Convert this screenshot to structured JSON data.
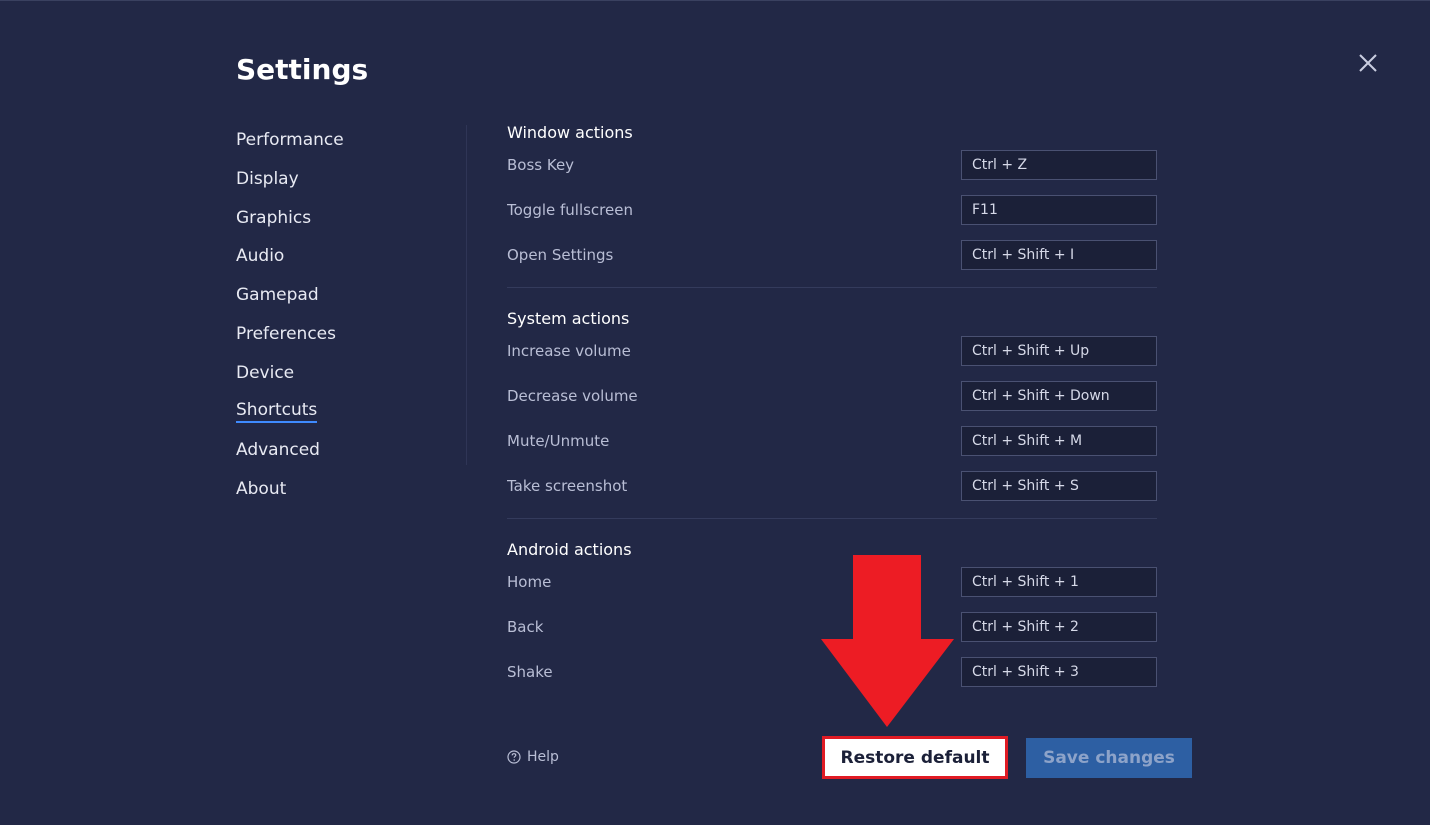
{
  "header": {
    "title": "Settings"
  },
  "sidebar": {
    "items": [
      {
        "label": "Performance"
      },
      {
        "label": "Display"
      },
      {
        "label": "Graphics"
      },
      {
        "label": "Audio"
      },
      {
        "label": "Gamepad"
      },
      {
        "label": "Preferences"
      },
      {
        "label": "Device"
      },
      {
        "label": "Shortcuts",
        "active": true
      },
      {
        "label": "Advanced"
      },
      {
        "label": "About"
      }
    ]
  },
  "sections": [
    {
      "title": "Window actions",
      "rows": [
        {
          "label": "Boss Key",
          "value": "Ctrl + Z"
        },
        {
          "label": "Toggle fullscreen",
          "value": "F11"
        },
        {
          "label": "Open Settings",
          "value": "Ctrl + Shift + I"
        }
      ]
    },
    {
      "title": "System actions",
      "rows": [
        {
          "label": "Increase volume",
          "value": "Ctrl + Shift + Up"
        },
        {
          "label": "Decrease volume",
          "value": "Ctrl + Shift + Down"
        },
        {
          "label": "Mute/Unmute",
          "value": "Ctrl + Shift + M"
        },
        {
          "label": "Take screenshot",
          "value": "Ctrl + Shift + S"
        }
      ]
    },
    {
      "title": "Android actions",
      "rows": [
        {
          "label": "Home",
          "value": "Ctrl + Shift + 1"
        },
        {
          "label": "Back",
          "value": "Ctrl + Shift + 2"
        },
        {
          "label": "Shake",
          "value": "Ctrl + Shift + 3"
        }
      ]
    }
  ],
  "footer": {
    "help_label": "Help",
    "restore_label": "Restore default",
    "save_label": "Save changes"
  },
  "icons": {
    "close": "close-icon",
    "help": "help-circle-icon",
    "annotation": "arrow-down-icon"
  },
  "colors": {
    "background": "#222846",
    "accent": "#3f8bff",
    "save_button": "#2d5fa3",
    "annotation_red": "#ed1c24"
  }
}
